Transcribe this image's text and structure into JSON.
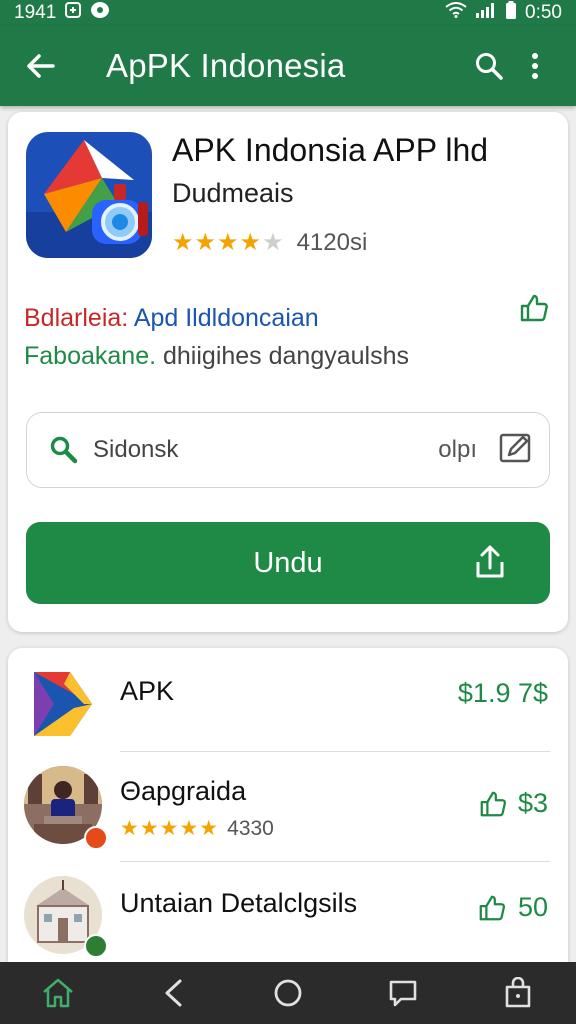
{
  "status_bar": {
    "time_left": "1941",
    "time_right": "0:50"
  },
  "app_bar": {
    "title": "ApPK Indonesia"
  },
  "app": {
    "name": "APK Indonsia APP lhd",
    "developer": "Dudmeais",
    "stars": 4.5,
    "rating_count": "4120si"
  },
  "description": {
    "line1_part1": "Bdlarleia:",
    "line1_part2": "Apd Ildldoncaian",
    "line2_part1": "Faboakane.",
    "line2_part2": "dhiigihes dangyaulshs"
  },
  "search": {
    "value": "Sidonsk",
    "extra": "olpı"
  },
  "download": {
    "label": "Undu"
  },
  "list": [
    {
      "title": "APK",
      "price": "$1.9 7$",
      "rating": null,
      "rating_text": ""
    },
    {
      "title": "Θapgraida",
      "price": "$3",
      "stars": 5,
      "rating_text": "4330",
      "badge_color": "#e64a19"
    },
    {
      "title": "Untaian Detalclgsils",
      "price": "50",
      "rating_text": "",
      "badge_color": "#2e7d32"
    }
  ],
  "colors": {
    "primary": "#1f7a47",
    "accent": "#1e8a46",
    "star": "#f4a400"
  }
}
